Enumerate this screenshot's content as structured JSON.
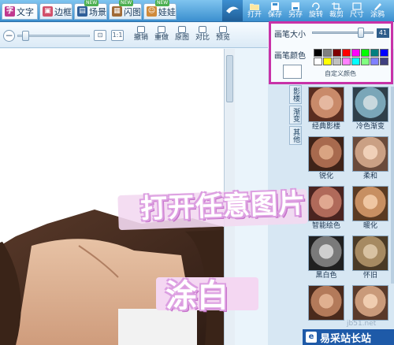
{
  "tabs": [
    {
      "label": "文字",
      "icon": "text-icon",
      "color": "#c0398f"
    },
    {
      "label": "边框",
      "icon": "frame-icon",
      "color": "#d2506a"
    },
    {
      "label": "场景",
      "icon": "scene-icon",
      "color": "#2f5f99"
    },
    {
      "label": "闪图",
      "icon": "gif-icon",
      "color": "#a06a36"
    },
    {
      "label": "娃娃",
      "icon": "doll-icon",
      "color": "#d08a3a"
    }
  ],
  "toolbar": {
    "open": "打开",
    "save": "保存",
    "save_as": "另存",
    "rotate": "旋转",
    "crop": "裁剪",
    "size": "尺寸",
    "doodle": "涂鸦"
  },
  "edit_bar": {
    "zoom_out_symbol": "−",
    "fit_symbol": "⊡",
    "actual_symbol": "1:1",
    "undo": "撤销",
    "redo": "重做",
    "original": "原图",
    "compare": "对比",
    "preview": "预览"
  },
  "brush_popup": {
    "size_label": "画笔大小",
    "size_value": "41",
    "color_label": "画笔颜色",
    "custom_color": "自定义颜色",
    "current_color": "#ffffff",
    "swatches": [
      "#000000",
      "#808080",
      "#800000",
      "#ff0000",
      "#ff00ff",
      "#00ff00",
      "#008080",
      "#0000ff",
      "#ffffff",
      "#ffff00",
      "#c0c0c0",
      "#ff80ff",
      "#00ffff",
      "#80ff80",
      "#8080ff",
      "#404080"
    ]
  },
  "side_tabs": [
    "影楼",
    "渐变",
    "其他"
  ],
  "effects": [
    {
      "label": "经典影楼",
      "tint": "#c98a6a"
    },
    {
      "label": "冷色渐变",
      "tint": "#7aa6b8"
    },
    {
      "label": "锐化",
      "tint": "#a86a4e"
    },
    {
      "label": "柔和",
      "tint": "#caa084"
    },
    {
      "label": "智能绘色",
      "tint": "#b06a5a"
    },
    {
      "label": "暖化",
      "tint": "#c78f62"
    },
    {
      "label": "黑白色",
      "tint": "#7a7a7a"
    },
    {
      "label": "怀旧",
      "tint": "#a68a62"
    },
    {
      "label": "",
      "tint": "#b37a5a"
    },
    {
      "label": "",
      "tint": "#c99a7a"
    }
  ],
  "overlay": {
    "caption_open": "打开任意图片",
    "caption_white": "涂白"
  },
  "watermark": {
    "url": "jb51.net",
    "site": "易采站长站"
  }
}
